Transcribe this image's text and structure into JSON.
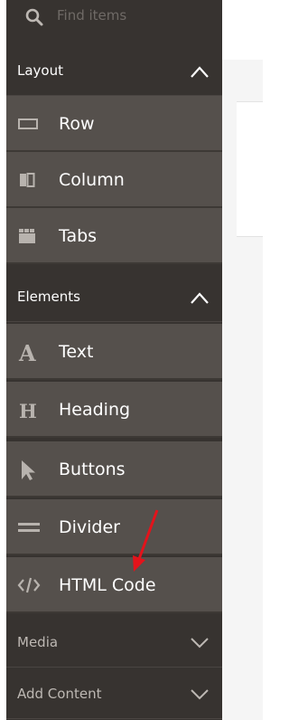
{
  "search": {
    "placeholder": "Find items",
    "icon": "search-icon"
  },
  "groups": [
    {
      "label": "Layout",
      "state": "expanded",
      "items": [
        {
          "label": "Row",
          "icon": "row-icon"
        },
        {
          "label": "Column",
          "icon": "column-icon"
        },
        {
          "label": "Tabs",
          "icon": "tabs-icon"
        }
      ]
    },
    {
      "label": "Elements",
      "state": "expanded",
      "items": [
        {
          "label": "Text",
          "icon": "text-icon"
        },
        {
          "label": "Heading",
          "icon": "heading-icon"
        },
        {
          "label": "Buttons",
          "icon": "buttons-icon"
        },
        {
          "label": "Divider",
          "icon": "divider-icon"
        },
        {
          "label": "HTML Code",
          "icon": "html-code-icon"
        }
      ]
    },
    {
      "label": "Media",
      "state": "collapsed",
      "items": []
    },
    {
      "label": "Add Content",
      "state": "collapsed",
      "items": []
    }
  ],
  "colors": {
    "panel": "#373330",
    "item": "#55504c",
    "annotation_arrow": "#e3131b"
  }
}
